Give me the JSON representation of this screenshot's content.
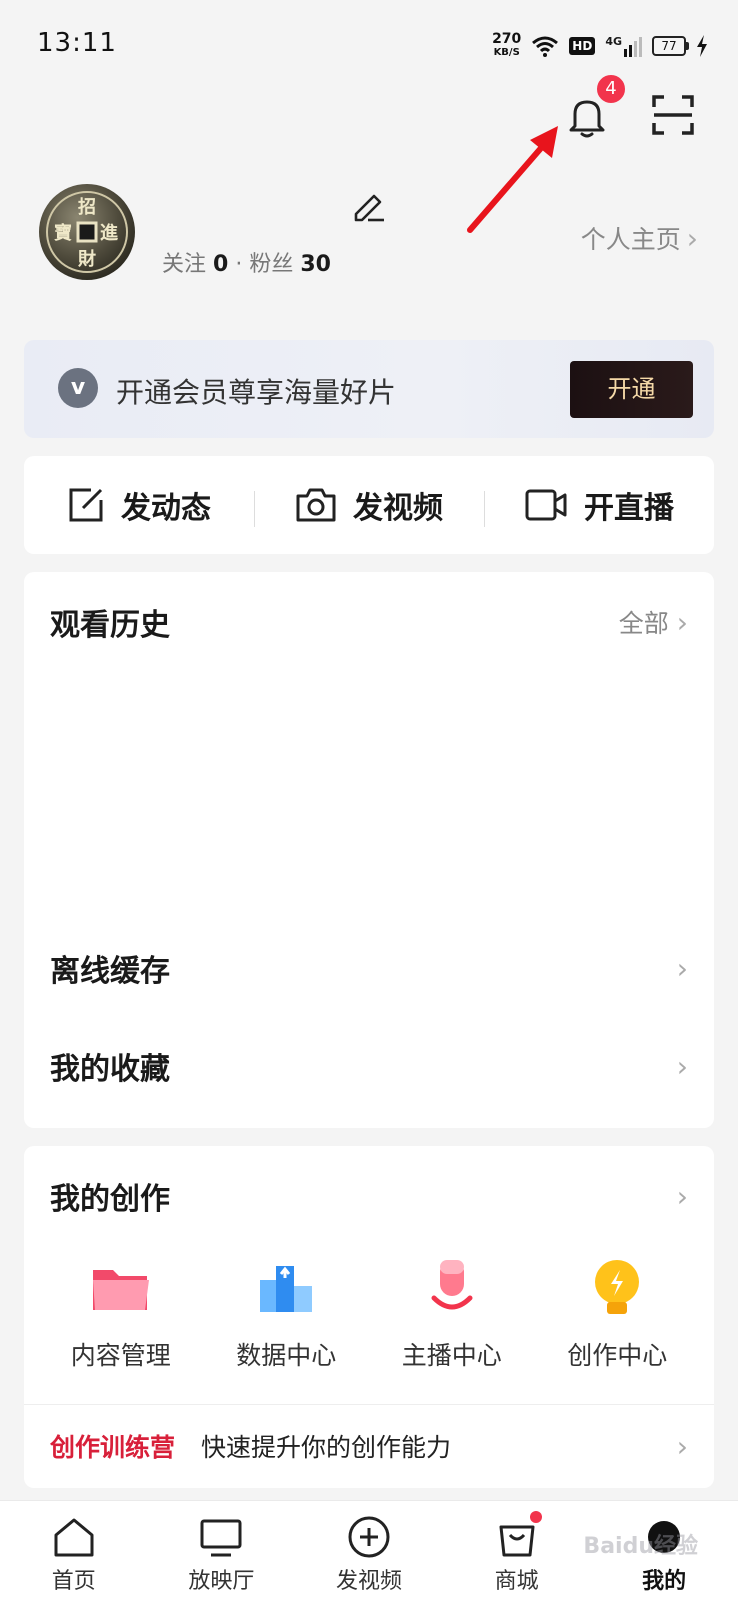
{
  "status_bar": {
    "time": "13:11",
    "speed_value": "270",
    "speed_unit": "KB/S",
    "hd": "HD",
    "network": "4G",
    "battery": "77"
  },
  "header": {
    "notification_count": "4"
  },
  "profile": {
    "follow_label": "关注",
    "follow_count": "0",
    "separator": "·",
    "fans_label": "粉丝",
    "fans_count": "30",
    "homepage_link": "个人主页"
  },
  "vip": {
    "icon_letter": "v",
    "text": "开通会员尊享海量好片",
    "button": "开通"
  },
  "actions": [
    {
      "label": "发动态",
      "icon": "edit-post-icon"
    },
    {
      "label": "发视频",
      "icon": "camera-icon"
    },
    {
      "label": "开直播",
      "icon": "live-camera-icon"
    }
  ],
  "history": {
    "title": "观看历史",
    "all_link": "全部"
  },
  "list_rows": [
    {
      "label": "离线缓存"
    },
    {
      "label": "我的收藏"
    }
  ],
  "creation": {
    "title": "我的创作",
    "tools": [
      {
        "label": "内容管理",
        "icon": "folder-icon"
      },
      {
        "label": "数据中心",
        "icon": "data-chart-icon"
      },
      {
        "label": "主播中心",
        "icon": "microphone-icon"
      },
      {
        "label": "创作中心",
        "icon": "lightbulb-icon"
      }
    ],
    "camp_highlight": "创作训练营",
    "camp_text": "快速提升你的创作能力"
  },
  "tabbar": [
    {
      "label": "首页",
      "icon": "home-icon"
    },
    {
      "label": "放映厅",
      "icon": "tv-icon"
    },
    {
      "label": "发视频",
      "icon": "add-circle-icon"
    },
    {
      "label": "商城",
      "icon": "shopping-bag-icon"
    },
    {
      "label": "我的",
      "icon": "profile-icon"
    }
  ],
  "watermark": "Baidu经验",
  "colors": {
    "accent_red": "#f2344c",
    "camp_red": "#d8203a",
    "vip_button_bg": "#1c1012",
    "vip_button_text": "#f5d9a8"
  }
}
